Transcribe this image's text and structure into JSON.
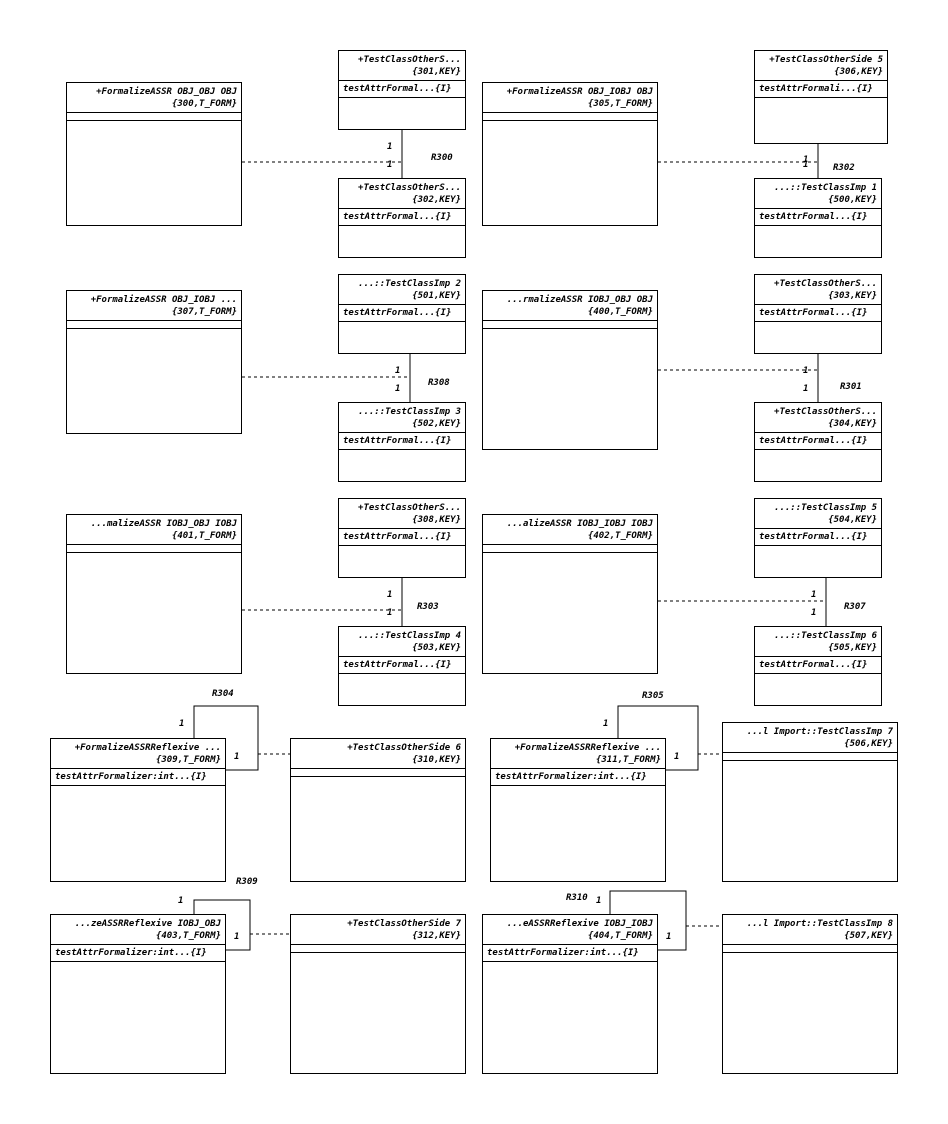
{
  "diagram": {
    "classes": [
      {
        "id": "c300",
        "header": [
          "+FormalizeASSR OBJ_OBJ OBJ",
          "{300,T_FORM}"
        ],
        "attrs": []
      },
      {
        "id": "c301",
        "header": [
          "+TestClassOtherS...",
          "{301,KEY}"
        ],
        "attrs": [
          "testAttrFormal...{I}"
        ]
      },
      {
        "id": "c302",
        "header": [
          "+TestClassOtherS...",
          "{302,KEY}"
        ],
        "attrs": [
          "testAttrFormal...{I}"
        ]
      },
      {
        "id": "c305",
        "header": [
          "+FormalizeASSR OBJ_IOBJ OBJ",
          "{305,T_FORM}"
        ],
        "attrs": []
      },
      {
        "id": "c306",
        "header": [
          "+TestClassOtherSide 5",
          "{306,KEY}"
        ],
        "attrs": [
          "testAttrFormali...{I}"
        ]
      },
      {
        "id": "c500",
        "header": [
          "...::TestClassImp 1",
          "{500,KEY}"
        ],
        "attrs": [
          "testAttrFormal...{I}"
        ]
      },
      {
        "id": "c307",
        "header": [
          "+FormalizeASSR OBJ_IOBJ ...",
          "{307,T_FORM}"
        ],
        "attrs": []
      },
      {
        "id": "c501",
        "header": [
          "...::TestClassImp 2",
          "{501,KEY}"
        ],
        "attrs": [
          "testAttrFormal...{I}"
        ]
      },
      {
        "id": "c502",
        "header": [
          "...::TestClassImp 3",
          "{502,KEY}"
        ],
        "attrs": [
          "testAttrFormal...{I}"
        ]
      },
      {
        "id": "c400",
        "header": [
          "...rmalizeASSR IOBJ_OBJ OBJ",
          "{400,T_FORM}"
        ],
        "attrs": []
      },
      {
        "id": "c303",
        "header": [
          "+TestClassOtherS...",
          "{303,KEY}"
        ],
        "attrs": [
          "testAttrFormal...{I}"
        ]
      },
      {
        "id": "c304",
        "header": [
          "+TestClassOtherS...",
          "{304,KEY}"
        ],
        "attrs": [
          "testAttrFormal...{I}"
        ]
      },
      {
        "id": "c401",
        "header": [
          "...malizeASSR IOBJ_OBJ IOBJ",
          "{401,T_FORM}"
        ],
        "attrs": []
      },
      {
        "id": "c308",
        "header": [
          "+TestClassOtherS...",
          "{308,KEY}"
        ],
        "attrs": [
          "testAttrFormal...{I}"
        ]
      },
      {
        "id": "c503",
        "header": [
          "...::TestClassImp 4",
          "{503,KEY}"
        ],
        "attrs": [
          "testAttrFormal...{I}"
        ]
      },
      {
        "id": "c402",
        "header": [
          "...alizeASSR IOBJ_IOBJ IOBJ",
          "{402,T_FORM}"
        ],
        "attrs": []
      },
      {
        "id": "c504",
        "header": [
          "...::TestClassImp 5",
          "{504,KEY}"
        ],
        "attrs": [
          "testAttrFormal...{I}"
        ]
      },
      {
        "id": "c505",
        "header": [
          "...::TestClassImp 6",
          "{505,KEY}"
        ],
        "attrs": [
          "testAttrFormal...{I}"
        ]
      },
      {
        "id": "c309",
        "header": [
          "+FormalizeASSRReflexive ...",
          "{309,T_FORM}"
        ],
        "attrs": [
          "testAttrFormalizer:int...{I}"
        ]
      },
      {
        "id": "c310",
        "header": [
          "+TestClassOtherSide 6",
          "{310,KEY}"
        ],
        "attrs": []
      },
      {
        "id": "c311",
        "header": [
          "+FormalizeASSRReflexive ...",
          "{311,T_FORM}"
        ],
        "attrs": [
          "testAttrFormalizer:int...{I}"
        ]
      },
      {
        "id": "c506",
        "header": [
          "...l Import::TestClassImp 7",
          "{506,KEY}"
        ],
        "attrs": []
      },
      {
        "id": "c403",
        "header": [
          "...zeASSRReflexive IOBJ_OBJ",
          "{403,T_FORM}"
        ],
        "attrs": [
          "testAttrFormalizer:int...{I}"
        ]
      },
      {
        "id": "c312",
        "header": [
          "+TestClassOtherSide 7",
          "{312,KEY}"
        ],
        "attrs": []
      },
      {
        "id": "c404",
        "header": [
          "...eASSRReflexive IOBJ_IOBJ",
          "{404,T_FORM}"
        ],
        "attrs": [
          "testAttrFormalizer:int...{I}"
        ]
      },
      {
        "id": "c507",
        "header": [
          "...l Import::TestClassImp 8",
          "{507,KEY}"
        ],
        "attrs": []
      }
    ],
    "relationships": [
      {
        "id": "R300",
        "multiplicities": [
          "1",
          "1"
        ]
      },
      {
        "id": "R302",
        "multiplicities": [
          "1",
          "1"
        ]
      },
      {
        "id": "R308",
        "multiplicities": [
          "1",
          "1"
        ]
      },
      {
        "id": "R301",
        "multiplicities": [
          "1",
          "1"
        ]
      },
      {
        "id": "R303",
        "multiplicities": [
          "1",
          "1"
        ]
      },
      {
        "id": "R307",
        "multiplicities": [
          "1",
          "1"
        ]
      },
      {
        "id": "R304",
        "multiplicities": [
          "1",
          "1"
        ]
      },
      {
        "id": "R305",
        "multiplicities": [
          "1",
          "1"
        ]
      },
      {
        "id": "R309",
        "multiplicities": [
          "1",
          "1"
        ]
      },
      {
        "id": "R310",
        "multiplicities": [
          "1",
          "1"
        ]
      }
    ]
  }
}
